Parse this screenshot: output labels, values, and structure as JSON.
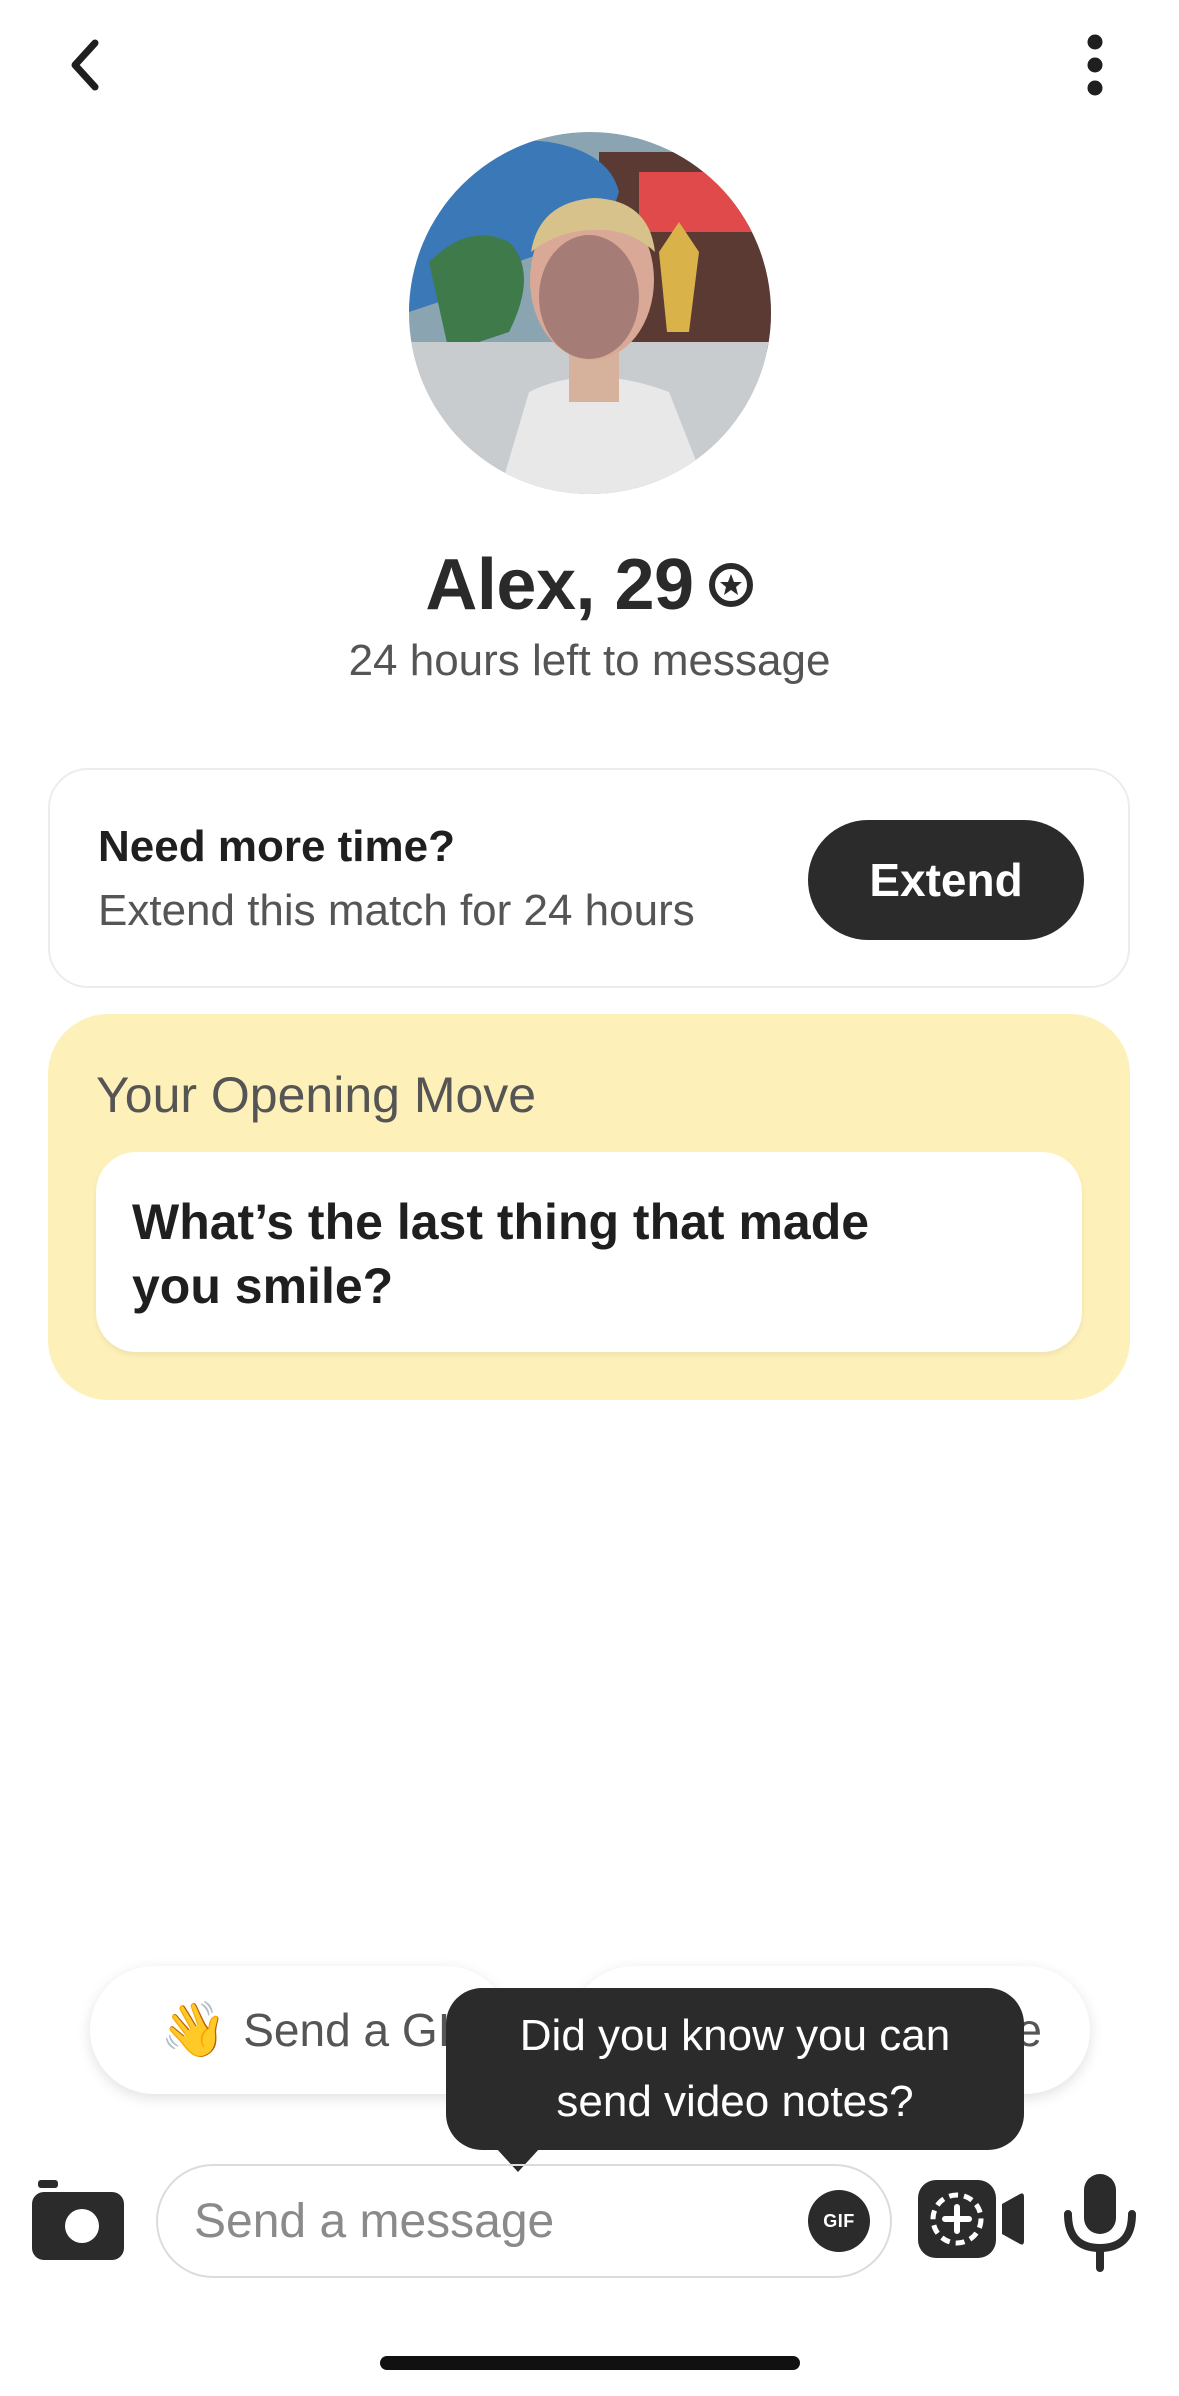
{
  "profile": {
    "name": "Alex, 29",
    "timer_text": "24 hours left to message"
  },
  "extend_card": {
    "title": "Need more time?",
    "subtitle": "Extend this match for 24 hours",
    "button_label": "Extend"
  },
  "opening_move": {
    "label": "Your Opening Move",
    "question": "What’s the last thing that made you smile?"
  },
  "quick_actions": {
    "gif_emoji": "👋",
    "gif_label": "Send a GIF",
    "right_chip_visible_text": "e"
  },
  "tooltip": {
    "text": "Did you know you can send video notes?"
  },
  "composer": {
    "placeholder": "Send a message",
    "value": "",
    "gif_label": "GIF"
  },
  "icons": {
    "back": "chevron-left-icon",
    "more": "vertical-dots-icon",
    "verified": "verified-badge-icon",
    "camera": "camera-icon",
    "video_note": "video-note-icon",
    "mic": "microphone-icon"
  },
  "colors": {
    "opening_move_bg": "#fdf0b8",
    "dark_button": "#2b2b2b"
  }
}
